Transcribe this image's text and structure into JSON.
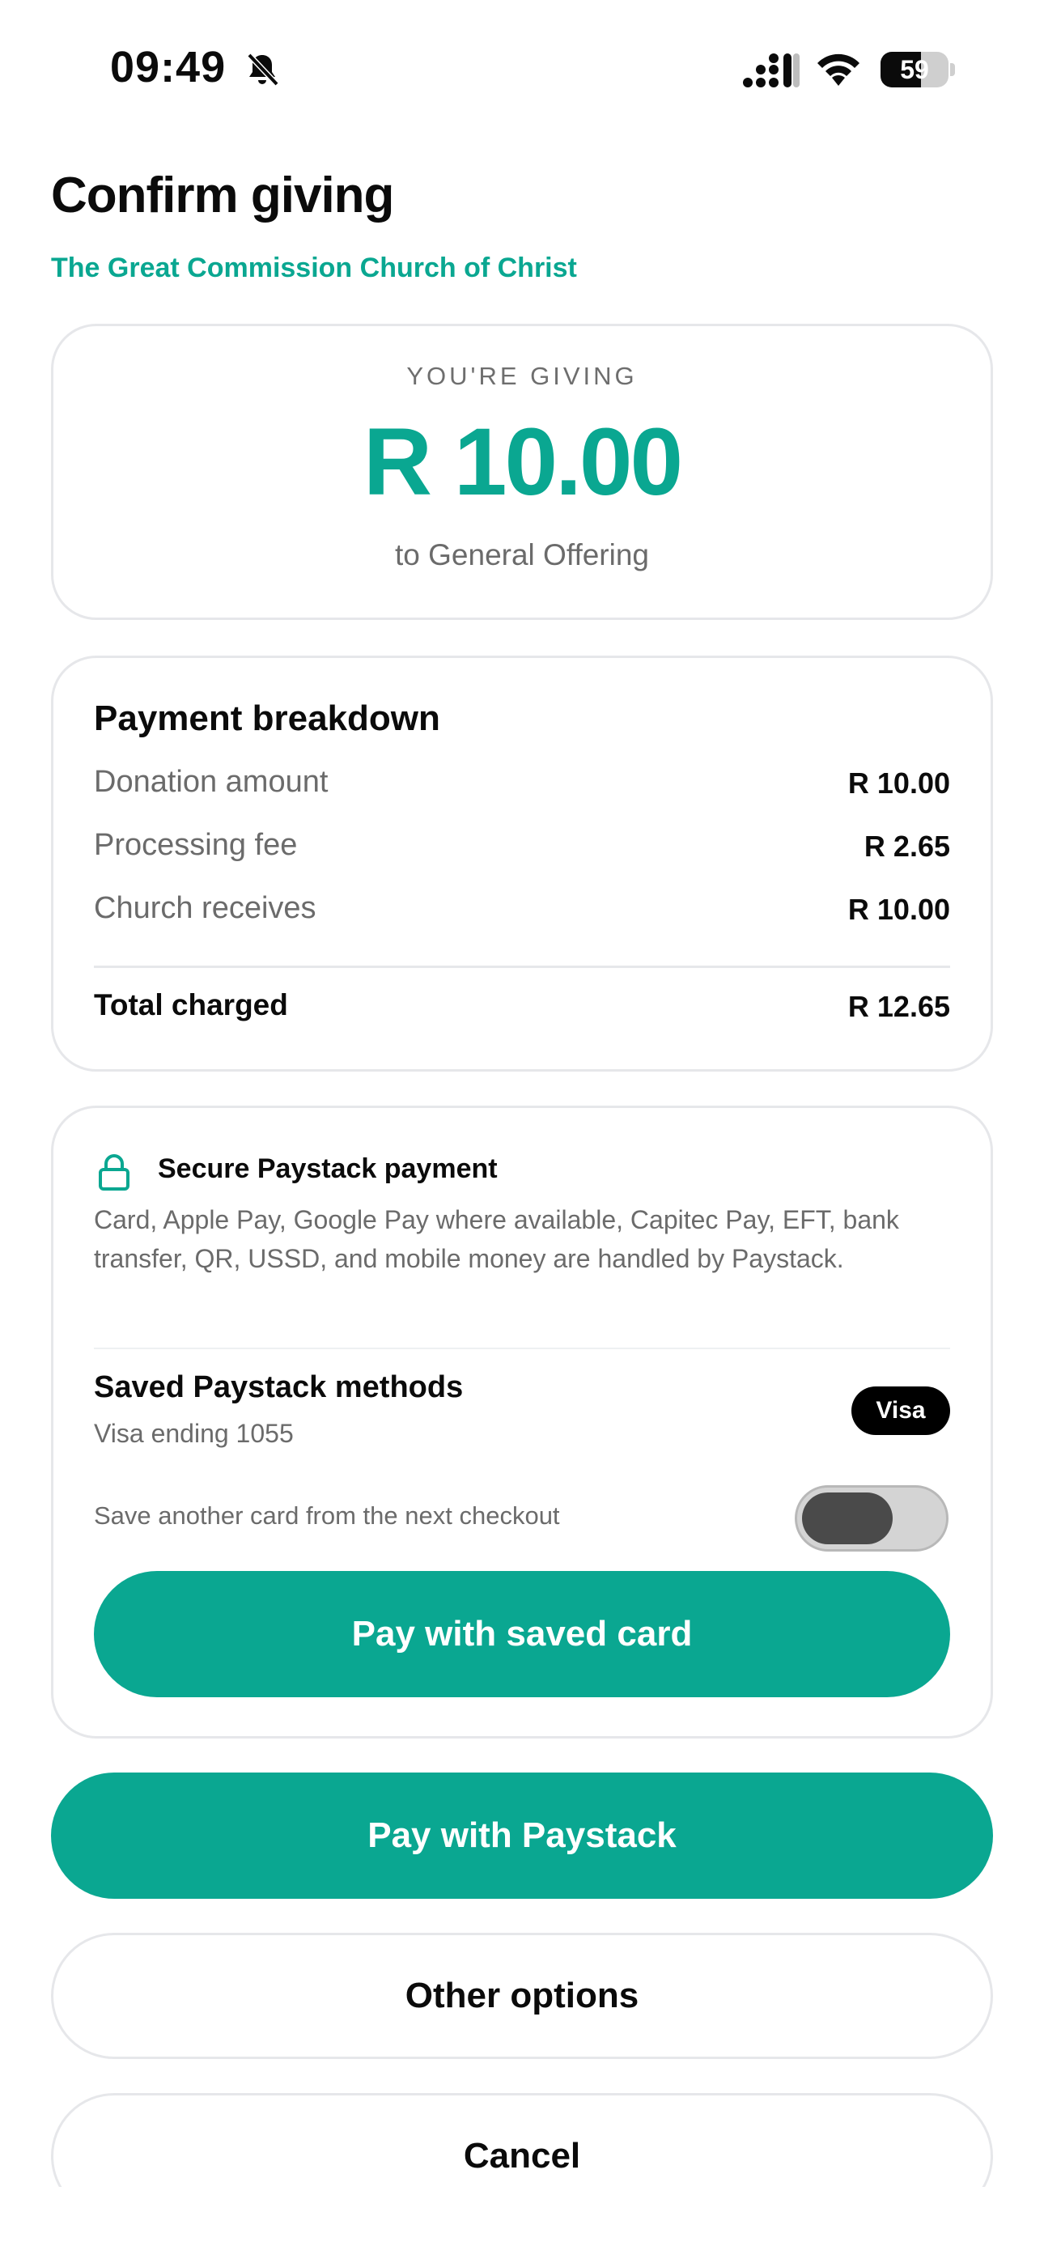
{
  "status_bar": {
    "time": "09:49",
    "battery": "59",
    "battery_level": 0.59
  },
  "header": {
    "title": "Confirm giving",
    "church": "The Great Commission Church of Christ"
  },
  "giving": {
    "label": "YOU'RE GIVING",
    "amount": "R 10.00",
    "fund": "to General Offering"
  },
  "breakdown": {
    "title": "Payment breakdown",
    "rows": [
      {
        "label": "Donation amount",
        "value": "R 10.00"
      },
      {
        "label": "Processing fee",
        "value": "R 2.65"
      },
      {
        "label": "Church receives",
        "value": "R 10.00"
      }
    ],
    "total": {
      "label": "Total charged",
      "value": "R 12.65"
    }
  },
  "secure": {
    "title": "Secure Paystack payment",
    "description": "Card, Apple Pay, Google Pay where available, Capitec Pay, EFT, bank transfer, QR, USSD, and mobile money are handled by Paystack.",
    "saved_title": "Saved Paystack methods",
    "saved_card": "Visa ending 1055",
    "card_brand": "Visa",
    "toggle_label": "Save another card from the next checkout",
    "toggle_on": false,
    "pay_saved_label": "Pay with saved card"
  },
  "actions": {
    "pay_paystack": "Pay with Paystack",
    "other_options": "Other options",
    "cancel": "Cancel"
  },
  "colors": {
    "accent": "#0aa791",
    "text": "#0b0b0b",
    "muted": "#6b6b6b",
    "border": "#e6e7ea"
  }
}
